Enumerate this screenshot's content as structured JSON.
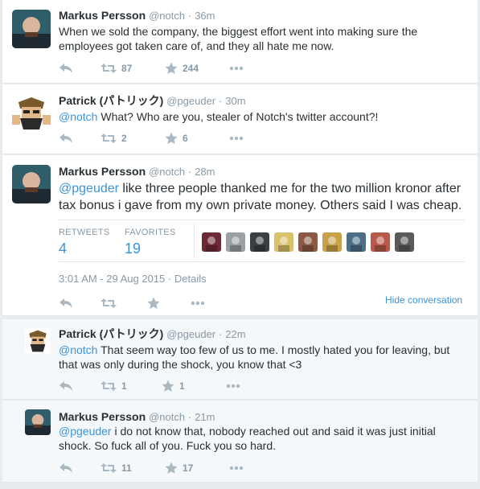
{
  "tweets": [
    {
      "fullname": "Markus Persson",
      "username": "@notch",
      "separator": "·",
      "time": "36m",
      "text": "When we sold the company, the biggest effort went into making sure the employees got taken care of, and they all hate me now.",
      "retweets": "87",
      "favorites": "244"
    },
    {
      "fullname": "Patrick (パトリック)",
      "username": "@pgeuder",
      "separator": "·",
      "time": "30m",
      "mention": "@notch",
      "text": " What? Who are you, stealer of Notch's twitter account?!",
      "retweets": "2",
      "favorites": "6"
    },
    {
      "fullname": "Markus Persson",
      "username": "@notch",
      "separator": "·",
      "time": "28m",
      "mention": "@pgeuder",
      "text": " like three people thanked me for the two million kronor after tax bonus i gave from my own private money. Others said I was cheap.",
      "retweets_label": "RETWEETS",
      "retweets": "4",
      "favorites_label": "FAVORITES",
      "favorites": "19",
      "timestamp": "3:01 AM - 29 Aug 2015",
      "details": "Details",
      "hide_conversation": "Hide conversation"
    },
    {
      "fullname": "Patrick (パトリック)",
      "username": "@pgeuder",
      "separator": "·",
      "time": "22m",
      "mention": "@notch",
      "text": " That seem way too few of us to me. I mostly hated you for leaving, but that was only during the shock, you know that <3",
      "retweets": "1",
      "favorites": "1"
    },
    {
      "fullname": "Markus Persson",
      "username": "@notch",
      "separator": "·",
      "time": "21m",
      "mention": "@pgeuder",
      "text": " i do not know that, nobody reached out and said it was just initial shock. So fuck all of you. Fuck you so hard.",
      "retweets": "11",
      "favorites": "17"
    }
  ],
  "colors": {
    "link": "#3b94d9",
    "muted": "#8899a6",
    "text": "#292f33",
    "face_colors": [
      "#6b2a35",
      "#9aa0a4",
      "#3a3f44",
      "#d9c26b",
      "#8c5a44",
      "#c9a14a",
      "#4a6f86",
      "#b85a4a",
      "#5a5a5a"
    ]
  },
  "icons": [
    "reply-icon",
    "retweet-icon",
    "favorite-icon",
    "more-icon"
  ]
}
